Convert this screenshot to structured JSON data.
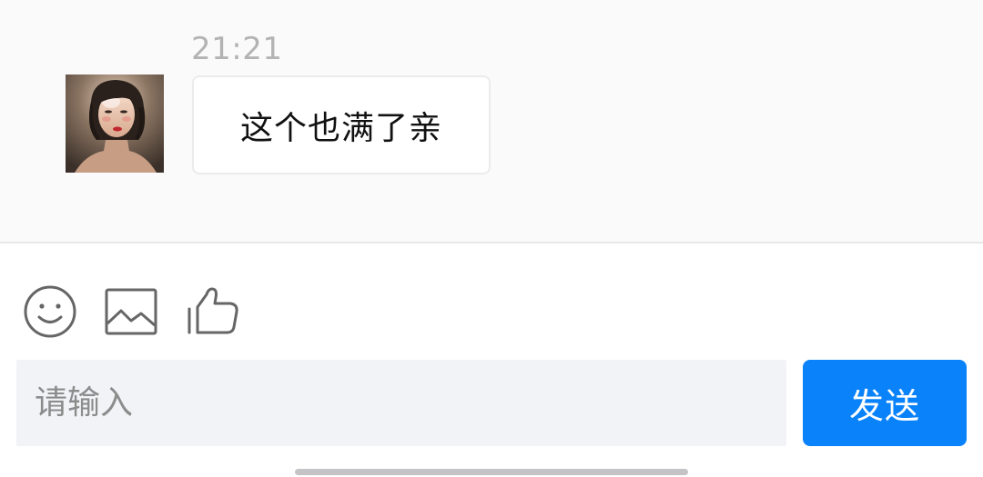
{
  "chat": {
    "timestamp": "21:21",
    "message": {
      "text": "这个也满了亲",
      "avatar": "user-avatar-photo"
    }
  },
  "toolbar": {
    "icons": [
      "emoji-icon",
      "image-icon",
      "thumbs-up-icon"
    ]
  },
  "composer": {
    "placeholder": "请输入",
    "value": "",
    "send_label": "发送"
  },
  "colors": {
    "accent": "#0a82fa",
    "chat_background": "#fafafb",
    "input_background": "#f2f3f7",
    "timestamp": "#b3b3b3"
  }
}
